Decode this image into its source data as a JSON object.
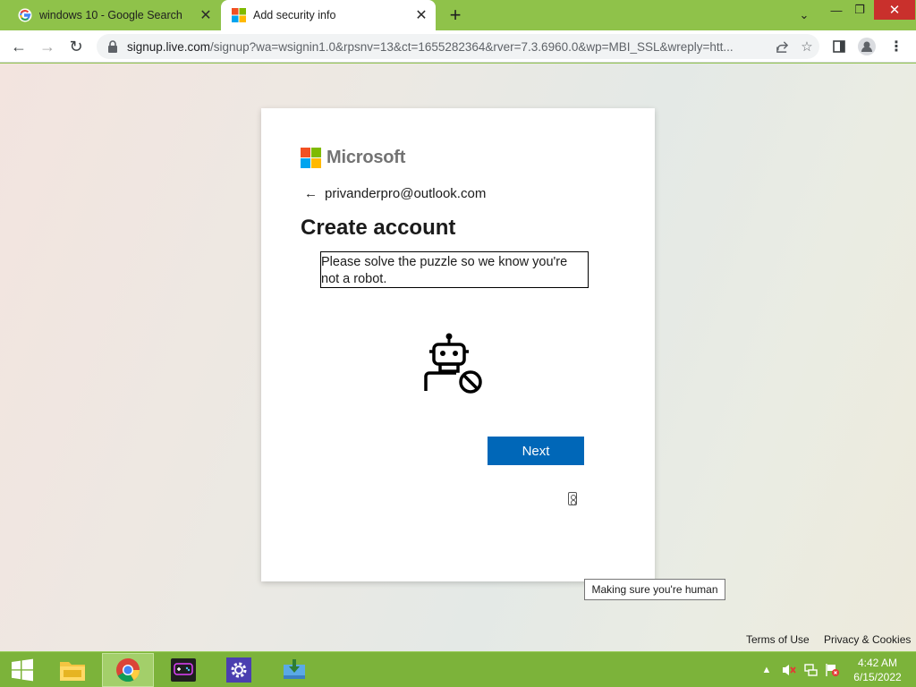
{
  "browser": {
    "tabs": [
      {
        "title": "windows 10 - Google Search",
        "favicon": "google-g-icon",
        "active": false
      },
      {
        "title": "Add security info",
        "favicon": "microsoft-logo-icon",
        "active": true
      }
    ],
    "new_tab_icon": "plus-icon",
    "window_controls": [
      "chevron-down-icon",
      "minimize-icon",
      "restore-icon",
      "close-icon"
    ],
    "nav": {
      "back": "back-arrow-icon",
      "forward": "forward-arrow-icon",
      "reload": "reload-icon"
    },
    "address": {
      "host": "signup.live.com",
      "path": "/signup?wa=wsignin1.0&rpsnv=13&ct=1655282364&rver=7.3.6960.0&wp=MBI_SSL&wreply=htt..."
    },
    "omnibox_icons": [
      "share-icon",
      "star-icon"
    ],
    "toolbar_icons": [
      "side-panel-icon",
      "profile-icon",
      "kebab-menu-icon"
    ]
  },
  "signup": {
    "brand": "Microsoft",
    "identity_email": "privanderpro@outlook.com",
    "heading": "Create account",
    "puzzle_text": "Please solve the puzzle so we know you're not a robot.",
    "next_label": "Next",
    "tooltip": "Making sure you're human"
  },
  "footer": {
    "terms": "Terms of Use",
    "privacy": "Privacy & Cookies"
  },
  "taskbar": {
    "apps": [
      "file-explorer-icon",
      "chrome-icon",
      "game-bar-icon",
      "settings-icon",
      "installer-icon"
    ],
    "active_app": "chrome-icon",
    "time": "4:42 AM",
    "date": "6/15/2022"
  },
  "colors": {
    "tabstrip": "#8fc24a",
    "primary_button": "#0067b8",
    "taskbar": "#7cb33a",
    "ms_red": "#f25022",
    "ms_green": "#7fba00",
    "ms_blue": "#00a4ef",
    "ms_yellow": "#ffb900"
  }
}
